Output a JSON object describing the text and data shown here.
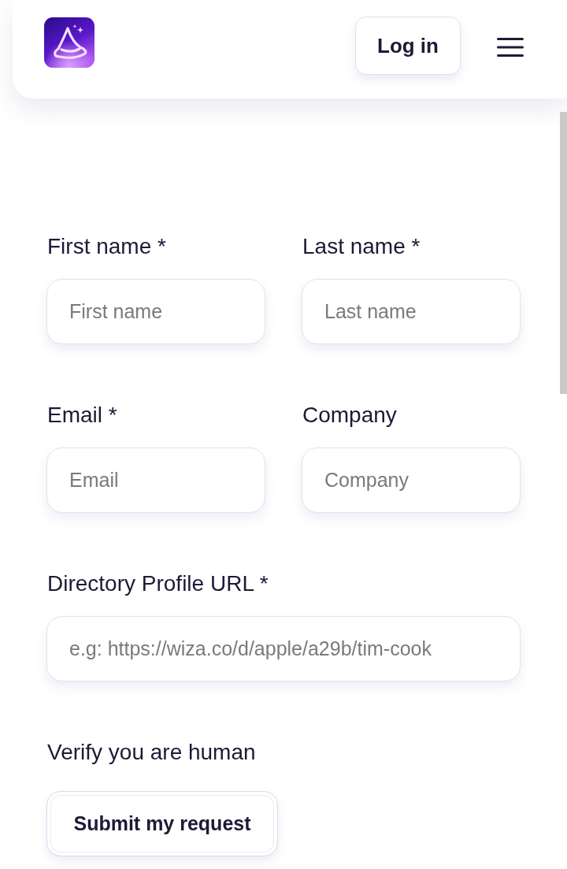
{
  "header": {
    "login_button": "Log in"
  },
  "form": {
    "rows": [
      {
        "fields": [
          {
            "label": "First name *",
            "placeholder": "First name"
          },
          {
            "label": "Last name *",
            "placeholder": "Last name"
          }
        ]
      },
      {
        "fields": [
          {
            "label": "Email *",
            "placeholder": "Email"
          },
          {
            "label": "Company",
            "placeholder": "Company"
          }
        ]
      },
      {
        "fields": [
          {
            "label": "Directory Profile URL *",
            "placeholder": "e.g: https://wiza.co/d/apple/a29b/tim-cook"
          }
        ]
      }
    ],
    "verify_label": "Verify you are human",
    "submit_button": "Submit my request"
  }
}
